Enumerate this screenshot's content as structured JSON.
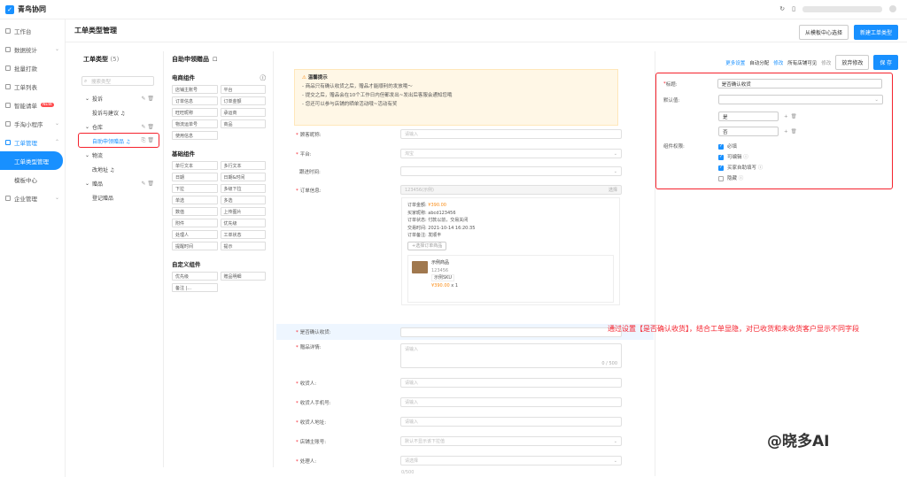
{
  "app": {
    "title": "青鸟协同"
  },
  "topbar": {
    "refresh_icon": "refresh-icon"
  },
  "sidebar": {
    "items": [
      {
        "label": "工作台"
      },
      {
        "label": "数据统计"
      },
      {
        "label": "批量打款"
      },
      {
        "label": "工单列表"
      },
      {
        "label": "智能请单",
        "badge": "NEW"
      },
      {
        "label": "手淘小程序"
      },
      {
        "label": "工单管理"
      },
      {
        "label": "工单类型管理"
      },
      {
        "label": "模板中心"
      },
      {
        "label": "企业管理"
      }
    ]
  },
  "header": {
    "title": "工单类型管理",
    "btn_template": "从模板中心选择",
    "btn_new": "新建工单类型"
  },
  "types_panel": {
    "title": "工单类型",
    "count": "(5)",
    "search_placeholder": "搜索类型",
    "items": [
      {
        "label": "投诉"
      },
      {
        "label": "投诉与建议 ♫"
      },
      {
        "label": "仓库"
      },
      {
        "label": "自助申领赠品 ♫"
      },
      {
        "label": "物流"
      },
      {
        "label": "改地址 ♫"
      },
      {
        "label": "赠品"
      },
      {
        "label": "登记赠品"
      }
    ]
  },
  "components_panel": {
    "title": "自助申领赠品",
    "ecom_title": "电商组件",
    "ecom": [
      "店铺主账号",
      "平台",
      "订单信息",
      "订单金额",
      "旺旺昵称",
      "承运商",
      "物流运单号",
      "商品",
      "使用信息"
    ],
    "basic_title": "基础组件",
    "basic": [
      "单行文本",
      "多行文本",
      "日期",
      "日期&时间",
      "下拉",
      "多级下拉",
      "单选",
      "多选",
      "数值",
      "上传图片",
      "附件",
      "优先级",
      "处理人",
      "工单状态",
      "提醒时间",
      "提示"
    ],
    "custom_title": "自定义组件",
    "custom": [
      "优先级",
      "赠品明细",
      "备注 |..."
    ]
  },
  "form": {
    "notice_title": "温馨提示",
    "notice_lines": [
      "- 商品只有确认收货之后，赠品才能顺利的发放哦～",
      "- 提交之后，赠品会在10个工作日内但都发出~发出后客服会通知您哦",
      "- 您还可以参与店铺的晒单活动哦~活动有奖"
    ],
    "fields": [
      {
        "label": "顾客昵称:",
        "required": true,
        "placeholder": "请输入"
      },
      {
        "label": "平台:",
        "required": true,
        "placeholder": "淘宝"
      },
      {
        "label": "跟进时间:",
        "required": false,
        "placeholder": ""
      },
      {
        "label": "订单信息:",
        "required": true,
        "placeholder": "123456(示例)"
      }
    ],
    "order_select": "选择",
    "order_info": [
      {
        "k": "订单金额:",
        "v": "¥390.00"
      },
      {
        "k": "买家昵称:",
        "v": "abcd123456"
      },
      {
        "k": "订单状态:",
        "v": "付款以前，交易关闭"
      },
      {
        "k": "交易时间:",
        "v": "2021-10-14 16:20:35"
      },
      {
        "k": "订单备注:",
        "v": "发顺丰"
      }
    ],
    "add_goods": "+选择订单商品",
    "goods_name": "示例商品",
    "goods_code": "123456",
    "goods_sku": "示例SKU",
    "goods_price": "¥390.00",
    "goods_qty": "x 1",
    "confirm_field": {
      "label": "是否确认收货:",
      "placeholder": ""
    },
    "detail_field": {
      "label": "赠品详情:",
      "placeholder": "请输入",
      "counter": "0 / 500"
    },
    "more_fields": [
      {
        "label": "收货人:",
        "placeholder": "请输入"
      },
      {
        "label": "收货人手机号:",
        "placeholder": "请输入"
      },
      {
        "label": "收货人地址:",
        "placeholder": "请输入"
      },
      {
        "label": "店铺主账号:",
        "placeholder": "默认不显示该下拉值"
      },
      {
        "label": "处理人:",
        "placeholder": "请选择"
      }
    ],
    "last_placeholder": "0/500"
  },
  "right_toolbar": {
    "more": "更多设置",
    "auto_assign": "自动分配",
    "modify": "修改",
    "visible": "所有店铺可见",
    "modify2": "修改",
    "discard": "放弃修改",
    "save": "保 存"
  },
  "props": {
    "title_label": "标题:",
    "title_value": "是否确认收货",
    "default_label": "默认值:",
    "option_yes": "是",
    "option_no": "否",
    "rights_label": "组件权限:",
    "perm": [
      {
        "label": "必填",
        "on": true
      },
      {
        "label": "可编辑",
        "on": true
      },
      {
        "label": "买家自助填写",
        "on": true
      },
      {
        "label": "隐藏",
        "on": false
      }
    ]
  },
  "annotation": "通过设置【是否确认收货】，结合工单显隐，对已收货和未收货客户显示不同字段",
  "watermark": "@晓多AI"
}
